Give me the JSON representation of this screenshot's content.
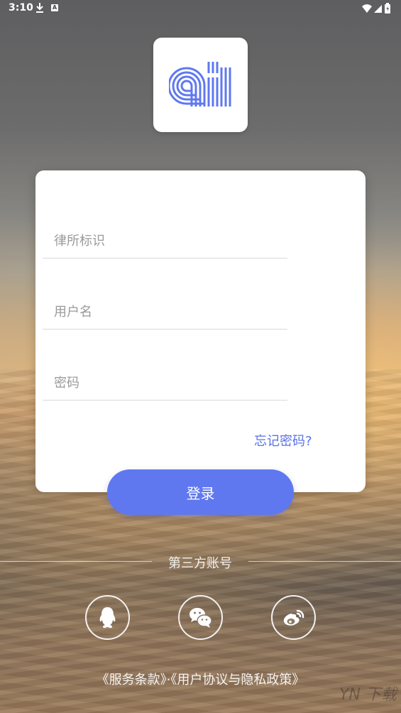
{
  "status_bar": {
    "time": "3:10",
    "icons": [
      "download-icon",
      "notification-a-icon",
      "wifi-icon",
      "cell-signal-icon",
      "battery-icon"
    ],
    "notification_letter": "A"
  },
  "app": {
    "logo_icon": "ai-logo-icon",
    "accent_color": "#5f78f0"
  },
  "form": {
    "firm_id_placeholder": "律所标识",
    "username_placeholder": "用户名",
    "password_placeholder": "密码",
    "forgot_password": "忘记密码?",
    "login_button": "登录"
  },
  "third_party": {
    "label": "第三方账号",
    "providers": [
      "qq-icon",
      "wechat-icon",
      "weibo-icon"
    ]
  },
  "footer": {
    "terms_of_service": "《服务条款》",
    "separator": "·",
    "user_agreement": "《用户协议与隐私政策》",
    "watermark": "YN 下载"
  }
}
